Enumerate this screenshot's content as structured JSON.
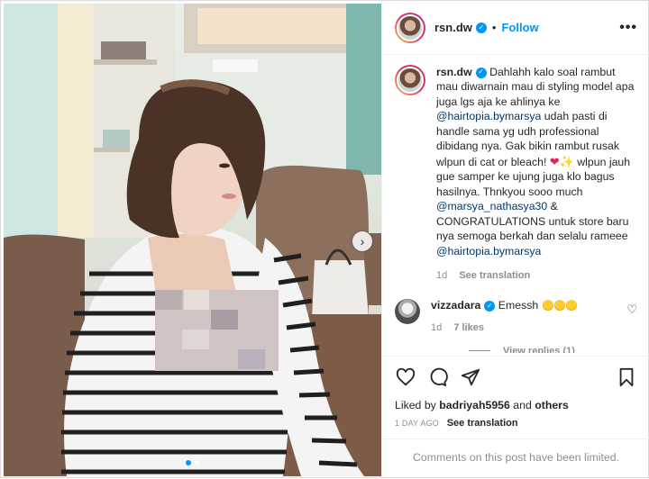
{
  "post": {
    "username": "rsn.dw",
    "follow_label": "Follow",
    "more_icon": "more-options-icon"
  },
  "caption": {
    "username": "rsn.dw",
    "text_1": "Dahlahh kalo soal rambut mau diwarnain mau di styling model apa juga lgs aja ke ahlinya ke",
    "mention_1": "@hairtopia.bymarsya",
    "text_2": "udah pasti di handle sama yg udh professional dibidang nya. Gak bikin rambut rusak wlpun di cat or bleach!",
    "text_3": "wlpun jauh gue samper ke ujung juga klo bagus hasilnya. Thnkyou sooo much",
    "mention_2": "@marsya_nathasya30",
    "text_4": "& CONGRATULATIONS untuk store baru nya semoga berkah dan selalu rameee",
    "mention_3": "@hairtopia.bymarsya",
    "age": "1d",
    "see_translation": "See translation"
  },
  "comment": {
    "username": "vizzadara",
    "text": "Emessh",
    "age": "1d",
    "likes": "7 likes"
  },
  "view_replies": "View replies (1)",
  "likes": {
    "prefix": "Liked by",
    "user": "badriyah5956",
    "and": "and",
    "others": "others"
  },
  "time": {
    "ago": "1 DAY AGO",
    "see_translation": "See translation"
  },
  "limited_notice": "Comments on this post have been limited.",
  "colors": {
    "accent": "#0095f6",
    "heart": "#e0245e"
  }
}
